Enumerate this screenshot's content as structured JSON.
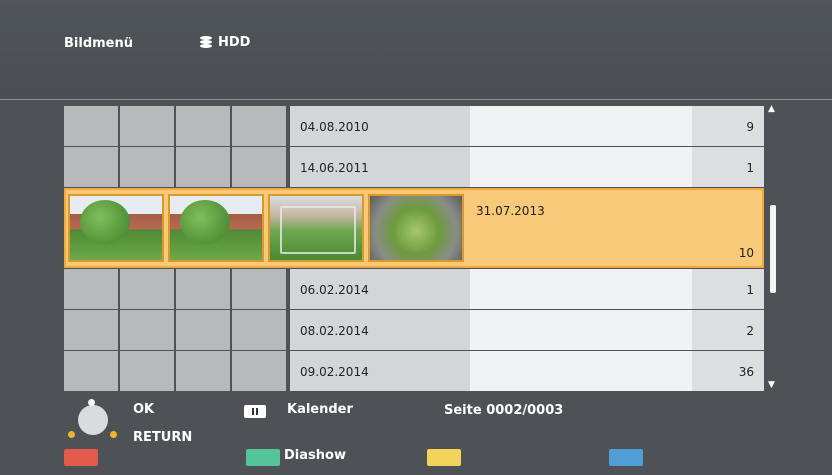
{
  "header": {
    "title": "Bildmenü",
    "source": "HDD",
    "source_icon": "database-icon"
  },
  "rows_top": [
    {
      "date": "04.08.2010",
      "count": "9",
      "thumbs": [
        "img-interior",
        "img-shelf",
        "img-room",
        "img-outdoor"
      ]
    },
    {
      "date": "14.06.2011",
      "count": "1",
      "thumbs": [
        "img-blue"
      ]
    }
  ],
  "selected": {
    "date": "31.07.2013",
    "count": "10"
  },
  "rows_bottom": [
    {
      "date": "06.02.2014",
      "count": "1",
      "thumbs": [
        "img-dark"
      ]
    },
    {
      "date": "08.02.2014",
      "count": "2",
      "thumbs": [
        "img-dark2",
        "img-dark2"
      ]
    },
    {
      "date": "09.02.2014",
      "count": "36",
      "thumbs": [
        "img-indoor",
        "img-indoor",
        "img-indoor",
        "img-indoor"
      ]
    }
  ],
  "footer": {
    "ok_label": "OK",
    "return_label": "RETURN",
    "calendar_label": "Kalender",
    "page_label": "Seite 0002/0003",
    "slideshow_label": "Diashow"
  },
  "colors": {
    "red": "#e35a4c",
    "green": "#54c49b",
    "yellow": "#f3d35a",
    "blue": "#4f9fd6",
    "highlight": "#f7c978"
  }
}
